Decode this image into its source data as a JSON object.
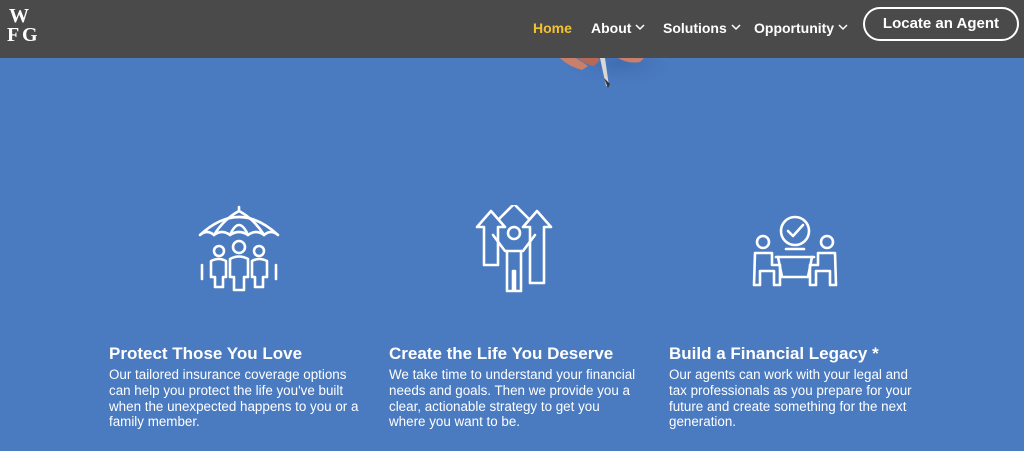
{
  "brand": {
    "logo_text": "WFG"
  },
  "nav": {
    "items": [
      {
        "label": "Home",
        "active": true
      },
      {
        "label": "About",
        "dropdown": true
      },
      {
        "label": "Solutions",
        "dropdown": true
      },
      {
        "label": "Opportunity",
        "dropdown": true
      }
    ],
    "cta_label": "Locate an Agent"
  },
  "colors": {
    "background": "#4a7ac0",
    "topbar": "#4a4a4a",
    "active_nav": "#f2c230",
    "text": "#ffffff"
  },
  "features": [
    {
      "icon": "family-umbrella-icon",
      "title": "Protect Those You Love",
      "text": "Our tailored insurance coverage options can help you protect the life you've built when the unexpected happens to you or a family member."
    },
    {
      "icon": "growth-arrows-person-icon",
      "title": "Create the Life You Deserve",
      "text": "We take time to understand your financial needs and goals. Then we provide you a clear, actionable strategy to get you where you want to be."
    },
    {
      "icon": "meeting-checkmark-icon",
      "title": "Build a Financial Legacy *",
      "text": "Our agents can work with your legal and tax professionals as you prepare for your future and create something for the next generation."
    }
  ]
}
